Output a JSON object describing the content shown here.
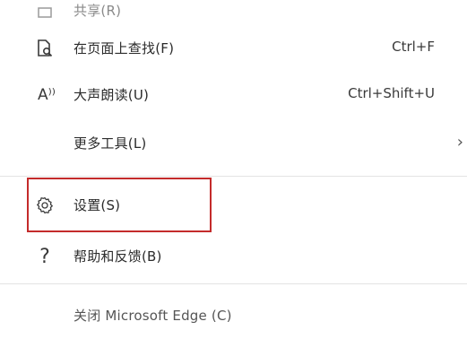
{
  "menu": {
    "items": [
      {
        "label": "共享(R)",
        "shortcut": "",
        "icon": "share-icon"
      },
      {
        "label": "在页面上查找(F)",
        "shortcut": "Ctrl+F",
        "icon": "find-on-page-icon"
      },
      {
        "label": "大声朗读(U)",
        "shortcut": "Ctrl+Shift+U",
        "icon": "read-aloud-icon",
        "icon_text": "A⁾⁾"
      },
      {
        "label": "更多工具(L)",
        "shortcut": "",
        "icon": "",
        "chevron": "›"
      },
      {
        "label": "设置(S)",
        "shortcut": "",
        "icon": "gear-icon",
        "highlighted": true
      },
      {
        "label": "帮助和反馈(B)",
        "shortcut": "",
        "icon": "help-icon",
        "icon_text": "?"
      },
      {
        "label": "关闭 Microsoft Edge (C)",
        "shortcut": "",
        "icon": ""
      }
    ]
  },
  "colors": {
    "highlight_border": "#c42b2b",
    "divider": "#e3e3e3",
    "text": "#2b2b2b"
  }
}
